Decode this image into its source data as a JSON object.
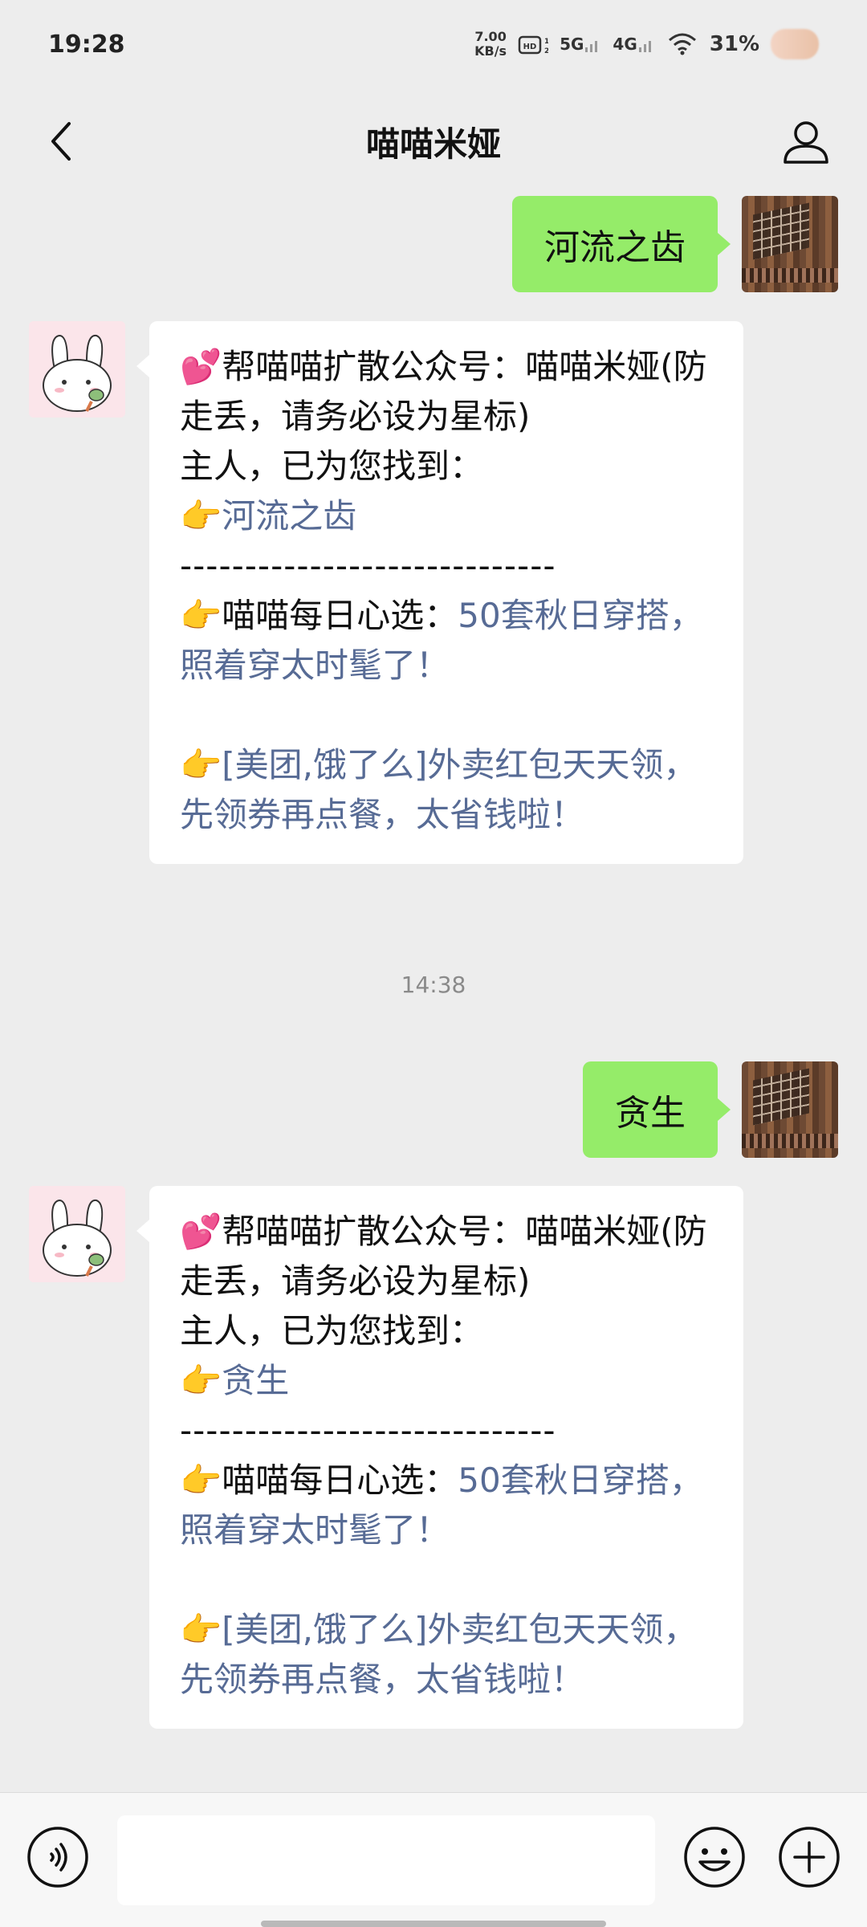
{
  "status_bar": {
    "time": "19:28",
    "net_speed_value": "7.00",
    "net_speed_unit": "KB/s",
    "hd_label": "HD",
    "signal_5g": "5G",
    "signal_4g": "4G",
    "battery": "31%"
  },
  "header": {
    "title": "喵喵米娅"
  },
  "messages": [
    {
      "type": "sent",
      "text": "河流之齿"
    },
    {
      "type": "received",
      "line1": "💕帮喵喵扩散公众号：喵喵米娅(防走丢，请务必设为星标)",
      "line2": "主人，已为您找到：",
      "result_prefix": "👉",
      "result": "河流之齿",
      "divider": "-----------------------------",
      "promo1_prefix": "👉喵喵每日心选：",
      "promo1_link": "50套秋日穿搭，照着穿太时髦了！",
      "promo2_prefix": "👉",
      "promo2_link": "[美团,饿了么]外卖红包天天领，先领券再点餐，太省钱啦！"
    },
    {
      "type": "time",
      "text": "14:38"
    },
    {
      "type": "sent",
      "text": "贪生"
    },
    {
      "type": "received",
      "line1": "💕帮喵喵扩散公众号：喵喵米娅(防走丢，请务必设为星标)",
      "line2": "主人，已为您找到：",
      "result_prefix": "👉",
      "result": "贪生",
      "divider": "-----------------------------",
      "promo1_prefix": "👉喵喵每日心选：",
      "promo1_link": "50套秋日穿搭，照着穿太时髦了！",
      "promo2_prefix": "👉",
      "promo2_link": "[美团,饿了么]外卖红包天天领，先领券再点餐，太省钱啦！"
    }
  ],
  "input": {
    "value": "",
    "placeholder": ""
  },
  "icons": {
    "back": "back-arrow-icon",
    "profile": "person-icon",
    "voice": "voice-icon",
    "emoji": "emoji-icon",
    "plus": "plus-icon"
  },
  "colors": {
    "sent_bubble": "#95ec69",
    "received_bubble": "#ffffff",
    "link": "#576b95",
    "background": "#ededed"
  }
}
